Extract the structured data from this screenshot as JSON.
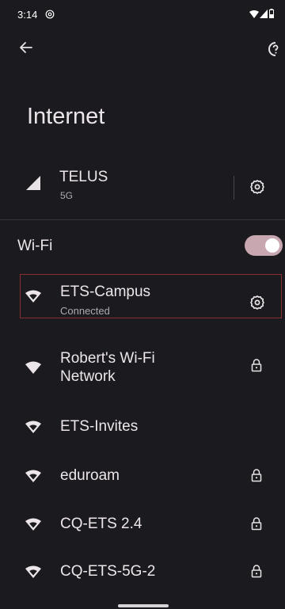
{
  "status_bar": {
    "time": "3:14",
    "icons": [
      "at-sign-icon",
      "wifi-icon",
      "signal-icon",
      "battery-icon"
    ]
  },
  "app_bar": {
    "back_icon": "arrow-left-icon",
    "help_icon": "help-icon"
  },
  "page": {
    "title": "Internet"
  },
  "mobile_network": {
    "name": "TELUS",
    "type": "5G",
    "icon": "signal-icon",
    "action_icon": "gear-icon"
  },
  "wifi": {
    "label": "Wi-Fi",
    "enabled": true,
    "toggle_color": "#c9a7b0"
  },
  "networks": [
    {
      "name": "ETS-Campus",
      "status": "Connected",
      "secured": false,
      "action": "gear-icon"
    },
    {
      "name": "Robert's Wi-Fi Network",
      "status": "",
      "secured": true,
      "action": "lock-icon"
    },
    {
      "name": "ETS-Invites",
      "status": "",
      "secured": false,
      "action": ""
    },
    {
      "name": "eduroam",
      "status": "",
      "secured": true,
      "action": "lock-icon"
    },
    {
      "name": "CQ-ETS 2.4",
      "status": "",
      "secured": true,
      "action": "lock-icon"
    },
    {
      "name": "CQ-ETS-5G-2",
      "status": "",
      "secured": true,
      "action": "lock-icon"
    }
  ],
  "colors": {
    "background": "#1b1b1f",
    "text_primary": "#ece6ea",
    "text_secondary": "#aea9ad",
    "highlight_border": "#8a2f2f"
  }
}
